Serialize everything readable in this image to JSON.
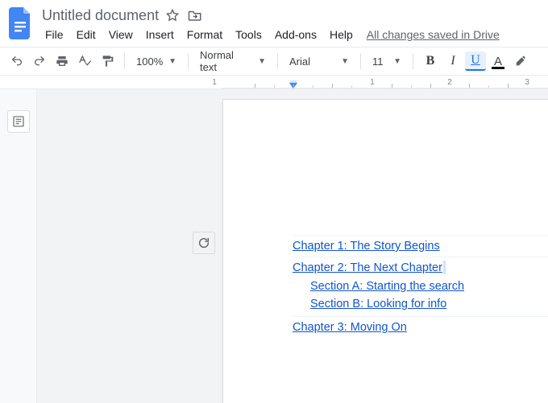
{
  "title": "Untitled document",
  "save_status": "All changes saved in Drive",
  "menus": [
    "File",
    "Edit",
    "View",
    "Insert",
    "Format",
    "Tools",
    "Add-ons",
    "Help"
  ],
  "toolbar": {
    "zoom": "100%",
    "paragraph_style": "Normal text",
    "font_family": "Arial",
    "font_size": "11"
  },
  "ruler": {
    "numbers": [
      "1",
      "1",
      "2",
      "3"
    ]
  },
  "toc": {
    "items": [
      {
        "label": "Chapter 1: The Story Begins",
        "level": 1
      },
      {
        "label": "Chapter 2: The Next Chapter",
        "level": 1,
        "caret": true,
        "children": [
          {
            "label": "Section A: Starting the search",
            "level": 2
          },
          {
            "label": "Section B: Looking for info",
            "level": 2
          }
        ]
      },
      {
        "label": "Chapter 3: Moving On",
        "level": 1
      }
    ]
  }
}
